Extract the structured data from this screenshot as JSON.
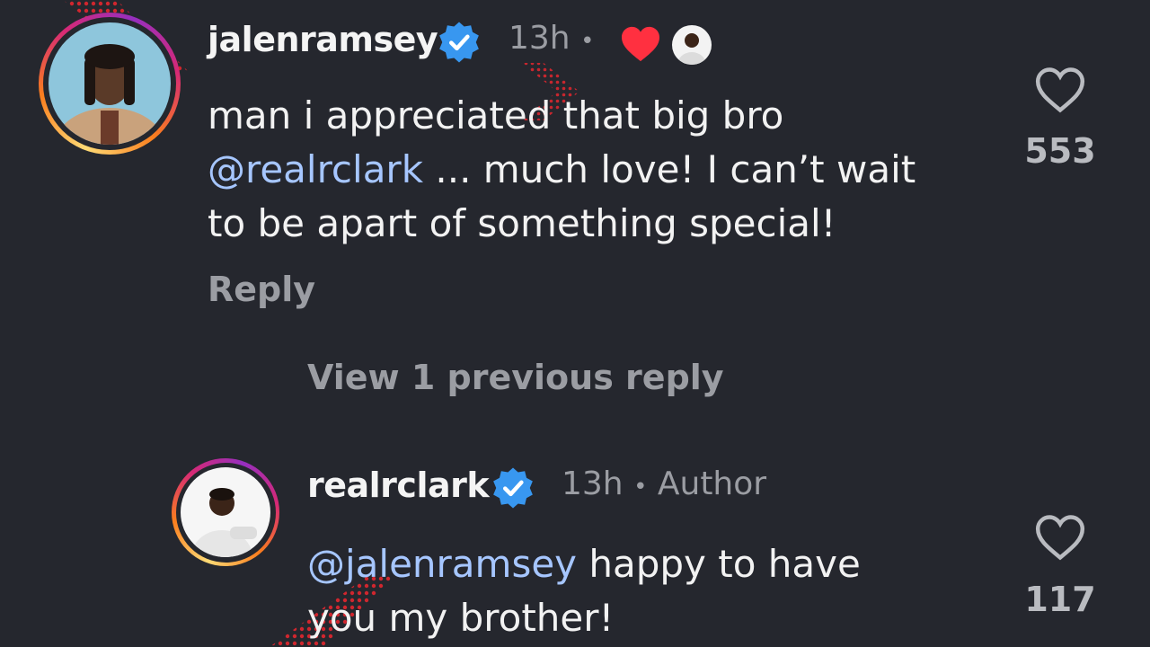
{
  "comments": [
    {
      "username": "jalenramsey",
      "time": "13h",
      "dot": "•",
      "text_line1": "man i appreciated that big bro",
      "mention": "@realrclark",
      "text_line2_rest": " ... much love! I can’t wait",
      "text_line3": "to be apart of something special!",
      "reply_label": "Reply",
      "likes": "553",
      "liked_by_author": true,
      "verified": true
    },
    {
      "username": "realrclark",
      "time": "13h",
      "dot": "•",
      "badge": "Author",
      "mention": "@jalenramsey",
      "text_line1_rest": " happy to have",
      "text_line2": "you my brother!",
      "likes": "117",
      "verified": true
    }
  ],
  "view_replies_label": "View 1 previous reply",
  "colors": {
    "background": "#25272e",
    "mention": "#a6c6ff",
    "verified": "#3897f0",
    "heart_red": "#ff3040",
    "muted": "#9b9da3"
  }
}
